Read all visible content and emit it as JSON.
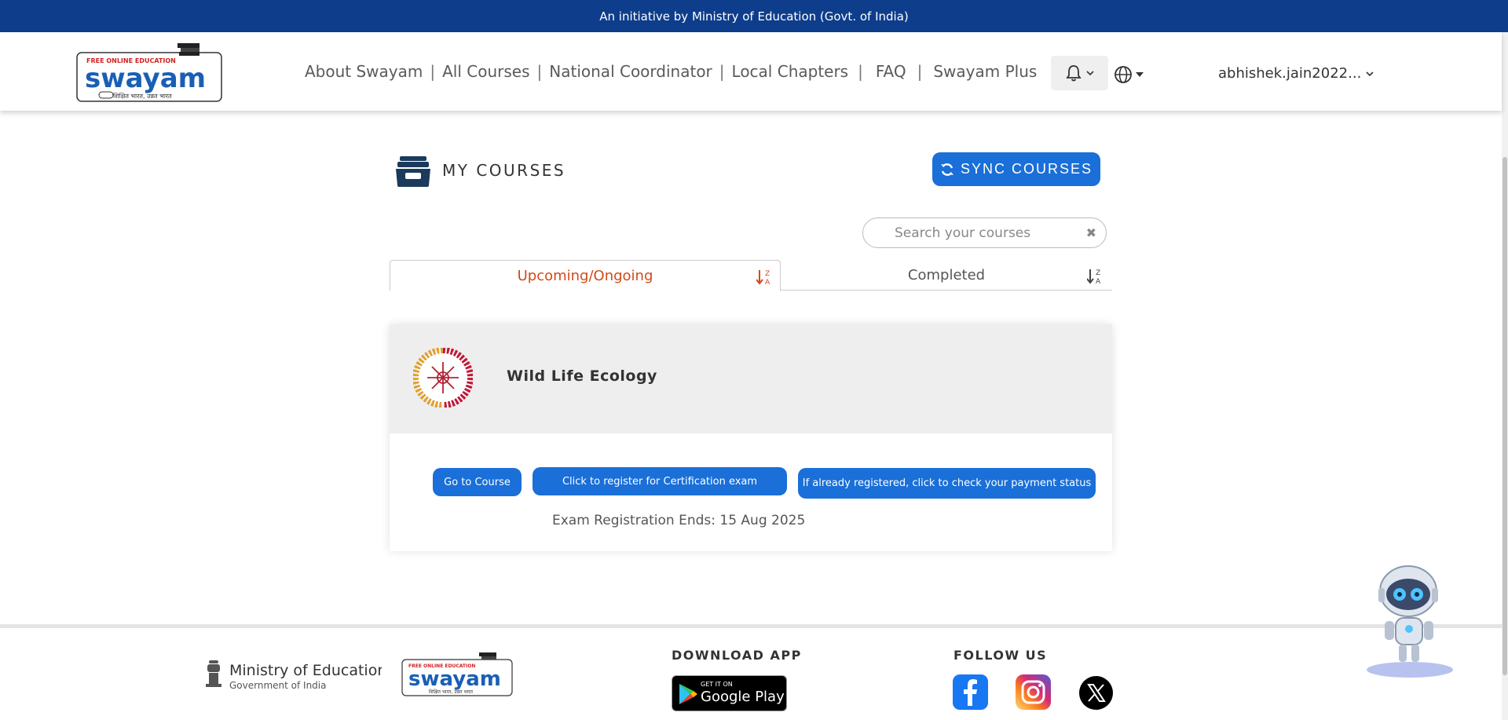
{
  "banner": {
    "text": "An initiative by Ministry of Education (Govt. of India)"
  },
  "logo": {
    "tagline": "FREE ONLINE EDUCATION",
    "brand": "swayam",
    "motto": "शिक्षित भारत, उन्नत भारत"
  },
  "nav": {
    "items": [
      "About Swayam",
      "All Courses",
      "National Coordinator",
      "Local Chapters",
      "FAQ",
      "Swayam Plus"
    ],
    "separator": "|",
    "user": "abhishek.jain2022..."
  },
  "icons": {
    "notification": "bell-icon",
    "language": "globe-icon",
    "my_courses": "archive-box-icon",
    "sync": "refresh-icon",
    "clear": "close-icon",
    "sort": "sort-za-icon"
  },
  "my_courses": {
    "title": "MY COURSES",
    "sync_label": "SYNC COURSES",
    "search_placeholder": "Search your courses"
  },
  "tabs": [
    {
      "label": "Upcoming/Ongoing",
      "active": true
    },
    {
      "label": "Completed",
      "active": false
    }
  ],
  "sort_label": {
    "top": "Z",
    "bottom": "A"
  },
  "course": {
    "name": "Wild Life Ecology",
    "buttons": {
      "go": "Go to Course",
      "register": "Click to register for Certification exam",
      "payment": "If already registered, click to check your payment status"
    },
    "exam_registration": "Exam Registration Ends: 15 Aug 2025"
  },
  "footer": {
    "ministry": {
      "title": "Ministry of Education",
      "subtitle": "Government of India"
    },
    "download_title": "DOWNLOAD APP",
    "gplay_small": "GET IT ON",
    "gplay_big": "Google Play",
    "follow_title": "FOLLOW US",
    "social": [
      "facebook-icon",
      "instagram-icon",
      "x-icon"
    ]
  },
  "colors": {
    "banner": "#0e3d8c",
    "primary_button": "#1a6fd8",
    "active_tab": "#d04a1a",
    "card_header": "#eeeeee"
  }
}
